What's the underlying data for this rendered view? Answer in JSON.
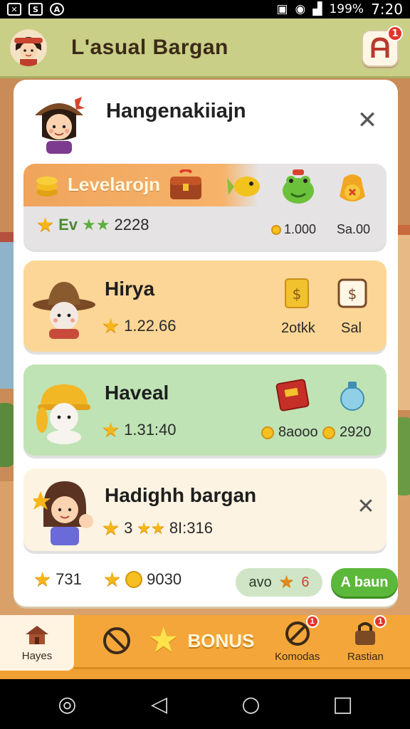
{
  "status_bar": {
    "battery": "199%",
    "time": "7:20",
    "icons": [
      "notification-icon",
      "sim-icon",
      "alert-icon",
      "download-icon",
      "wifi-icon",
      "signal-icon"
    ]
  },
  "header": {
    "title": "L'asual Bargan",
    "corner_badge": "1"
  },
  "panel": {
    "title": "Hangenakiiajn",
    "level_card": {
      "name": "Levelarojn",
      "rating": "2228",
      "stars_text": "Ev",
      "reward_1": "1.000",
      "reward_2": "Sa.00"
    },
    "cards": [
      {
        "name": "Hirya",
        "value": "1.22.66",
        "label_a": "2otkk",
        "label_b": "Sal"
      },
      {
        "name": "Haveal",
        "value": "1.31:40",
        "label_a": "8aooo",
        "label_b": "2920"
      },
      {
        "name": "Hadighh bargan",
        "value": "8I:316",
        "stars_num": "3"
      }
    ],
    "footer": {
      "stat_1": "731",
      "stat_2": "9030",
      "pill_label": "avo",
      "pill_count": "6",
      "action": "A baun"
    }
  },
  "nav": {
    "home": "Hayes",
    "bonus": "BONUS",
    "komodas": "Komodas",
    "komodas_badge": "1",
    "rastian": "Rastian",
    "rastian_badge": "1"
  },
  "colors": {
    "header_bg": "#c9cf86",
    "nav_bg": "#f4a63a",
    "card_hirya": "#fbd696",
    "card_haveal": "#bfe3b5",
    "accent_green": "#5cb83a"
  }
}
